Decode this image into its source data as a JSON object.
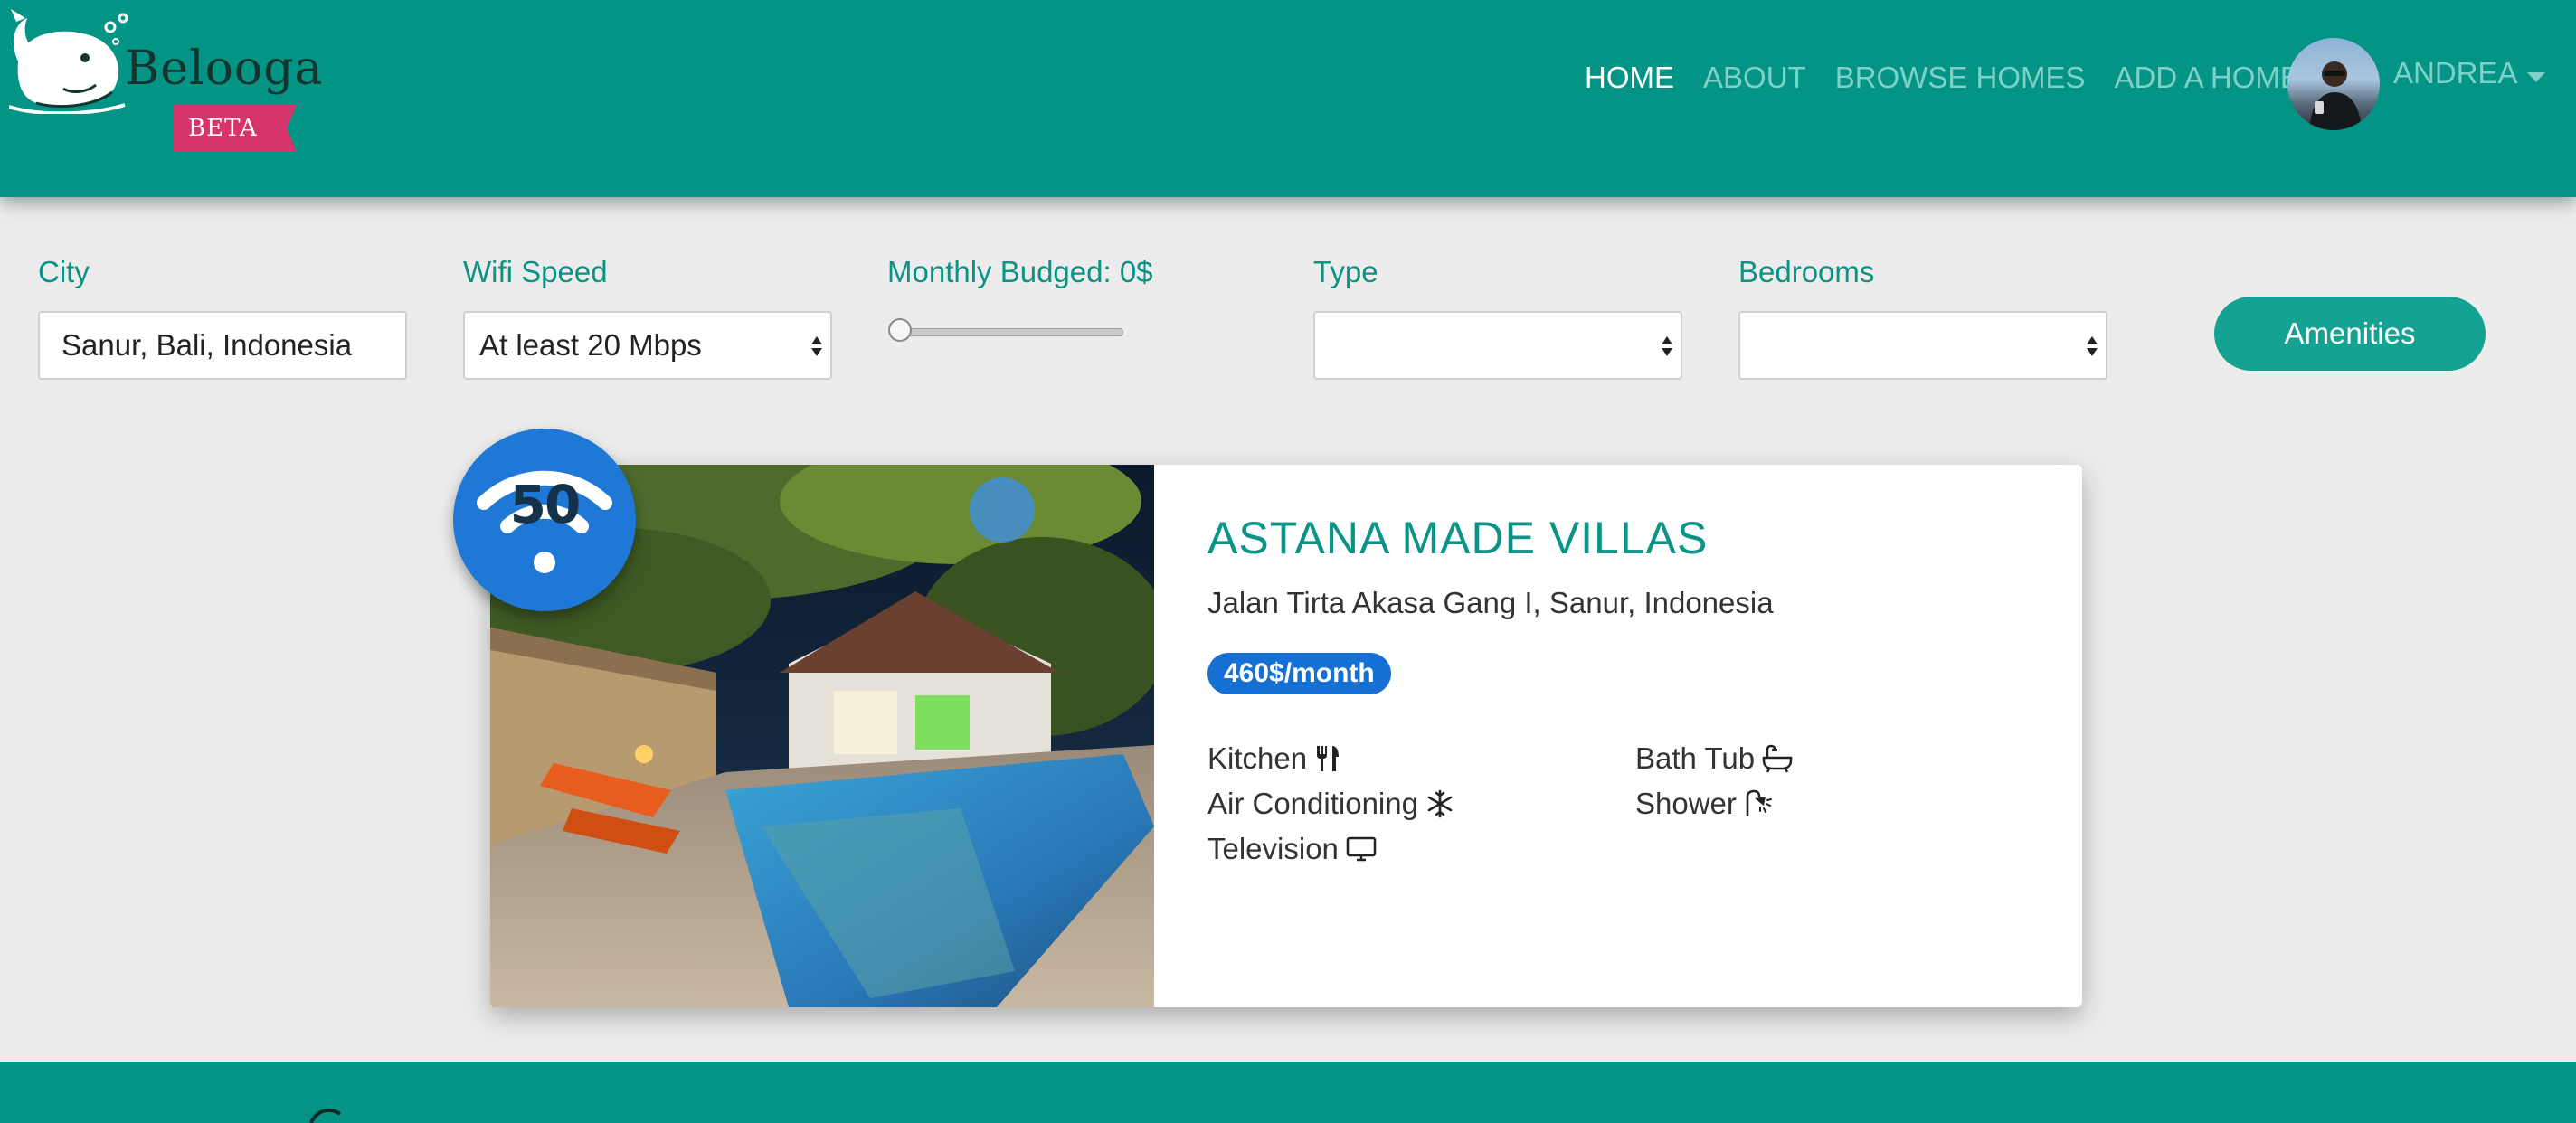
{
  "app": {
    "logo_text": "Belooga",
    "beta_label": "BETA",
    "logo_icon": "beluga-whale-icon"
  },
  "nav": {
    "home": "HOME",
    "about": "ABOUT",
    "browse_homes": "BROWSE HOMES",
    "add_home": "ADD A HOME",
    "user_name": "ANDREA",
    "user_menu_icon": "caret-down-icon"
  },
  "filters": {
    "city_label": "City",
    "city_value": "Sanur, Bali, Indonesia",
    "wifi_label": "Wifi Speed",
    "wifi_value": "At least 20 Mbps",
    "budget_label": "Monthly Budged: 0$",
    "budget_value": 0,
    "type_label": "Type",
    "type_value": "",
    "bedrooms_label": "Bedrooms",
    "bedrooms_value": "",
    "amenities_button": "Amenities"
  },
  "listing": {
    "wifi_speed": "50",
    "title": "ASTANA MADE VILLAS",
    "address": "Jalan Tirta Akasa Gang I, Sanur, Indonesia",
    "price": "460$/month",
    "amenities": [
      {
        "label": "Kitchen",
        "icon": "utensils-icon"
      },
      {
        "label": "Bath Tub",
        "icon": "bathtub-icon"
      },
      {
        "label": "Air Conditioning",
        "icon": "snowflake-icon"
      },
      {
        "label": "Shower",
        "icon": "shower-icon"
      },
      {
        "label": "Television",
        "icon": "monitor-icon"
      }
    ]
  },
  "colors": {
    "brand": "#039486",
    "accent": "#14a392",
    "beta": "#d6356b",
    "wifi_badge": "#1f78d6",
    "price_badge": "#1670d3"
  }
}
